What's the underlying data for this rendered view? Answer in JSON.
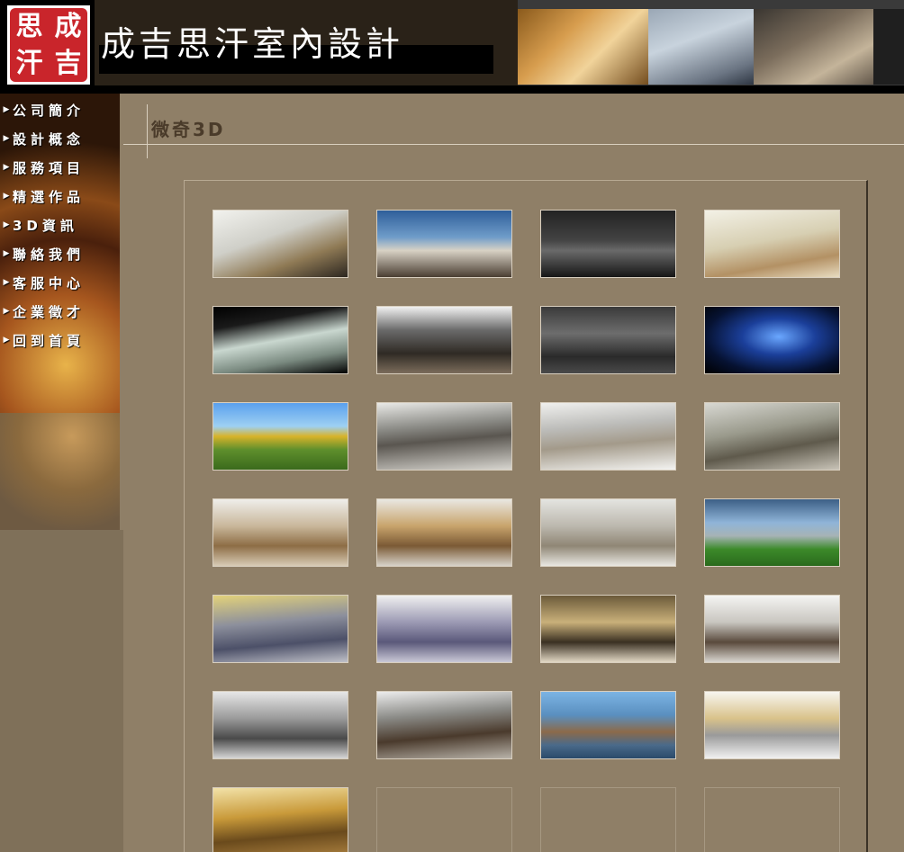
{
  "header": {
    "logo_chars": [
      "思",
      "成",
      "汗",
      "吉"
    ],
    "site_title": "成吉思汗室內設計"
  },
  "sidebar": {
    "items": [
      {
        "label": "公司簡介",
        "name": "company-intro"
      },
      {
        "label": "設計概念",
        "name": "design-concept"
      },
      {
        "label": "服務項目",
        "name": "services"
      },
      {
        "label": "精選作品",
        "name": "featured-works"
      },
      {
        "label": "3D資訊",
        "name": "3d-info"
      },
      {
        "label": "聯絡我們",
        "name": "contact-us"
      },
      {
        "label": "客服中心",
        "name": "customer-service"
      },
      {
        "label": "企業徵才",
        "name": "careers"
      },
      {
        "label": "回到首頁",
        "name": "home"
      }
    ]
  },
  "main": {
    "page_title": "微奇3D"
  },
  "gallery": {
    "thumbnails": [
      {
        "name": "white-ceiling-office-render",
        "bg": "linear-gradient(160deg,#f2f2ee 0%,#cfcfc8 40%,#8f7a55 70%,#2c2620 100%)"
      },
      {
        "name": "townhouse-exterior-render",
        "bg": "linear-gradient(180deg,#2f5f9a 0%,#6f9cc9 40%,#d8d2c5 60%,#4a3e32 100%)"
      },
      {
        "name": "dark-showroom-render",
        "bg": "linear-gradient(180deg,#222 0%,#444 45%,#6a6a6a 60%,#151515 100%)"
      },
      {
        "name": "living-dining-render",
        "bg": "linear-gradient(170deg,#f3f1e6 0%,#d7cfb2 45%,#b39164 75%,#e8dcc0 100%)"
      },
      {
        "name": "glass-building-render",
        "bg": "linear-gradient(170deg,#000 0%,#1a1a1a 25%,#c9d7cf 50%,#7a8a80 75%,#000 100%)"
      },
      {
        "name": "dark-dining-room-render",
        "bg": "linear-gradient(180deg,#f1f1f1 0%,#6a6a6a 35%,#2f2a24 70%,#7b6c5b 100%)"
      },
      {
        "name": "corridor-render",
        "bg": "linear-gradient(180deg,#3a3a3a 0%,#6d6d6d 40%,#2a2a2a 75%,#4a4a4a 100%)"
      },
      {
        "name": "exhibition-booth-render",
        "bg": "radial-gradient(ellipse at 55% 45%,#6aa7ff 0%,#1b3f9a 35%,#061232 70%,#000 100%)"
      },
      {
        "name": "cafe-terrace-render",
        "bg": "linear-gradient(180deg,#5aa0ee 0%,#9ed0f2 35%,#d8b32a 50%,#5f8f2c 70%,#3a6a1c 100%)"
      },
      {
        "name": "living-room-white-sofa-render",
        "bg": "linear-gradient(175deg,#e9e9e6 0%,#8b8b86 35%,#5a5650 55%,#d8d6d0 100%)"
      },
      {
        "name": "living-room-window-render",
        "bg": "linear-gradient(175deg,#f0f0ee 0%,#bcbcb9 35%,#a39a8a 60%,#f4f4f2 100%)"
      },
      {
        "name": "dining-balcony-render",
        "bg": "linear-gradient(170deg,#d8d8d2 0%,#9a9a8c 40%,#5f5a4c 65%,#c9c4b8 100%)"
      },
      {
        "name": "tv-wall-render",
        "bg": "linear-gradient(180deg,#efeeea 0%,#c9b79b 40%,#8d6d45 70%,#d8cbb5 100%)"
      },
      {
        "name": "living-wood-panel-render",
        "bg": "linear-gradient(180deg,#e9e7e2 0%,#c8a46c 40%,#7b5a35 70%,#d7d2c9 100%)"
      },
      {
        "name": "kitchen-dining-render",
        "bg": "linear-gradient(180deg,#e4e4e0 0%,#bcb8ae 40%,#8f8675 70%,#e9e7e1 100%)"
      },
      {
        "name": "villa-pool-render",
        "bg": "linear-gradient(180deg,#3c5f86 0%,#8fb4d8 35%,#a6b3b5 55%,#3c8a2a 75%,#2a6a1c 100%)"
      },
      {
        "name": "blue-kitchen-render",
        "bg": "linear-gradient(175deg,#e3d27a 0%,#8c8f9c 40%,#4c5068 70%,#bfc0c8 100%)"
      },
      {
        "name": "purple-kitchen-render",
        "bg": "linear-gradient(180deg,#f0f0f0 0%,#9c9ab4 40%,#5a587a 70%,#c9c8d6 100%)"
      },
      {
        "name": "bathroom-render",
        "bg": "linear-gradient(180deg,#6b5a3a 0%,#c9b07a 40%,#3a3022 70%,#e2d8c4 100%)"
      },
      {
        "name": "dining-pendant-render",
        "bg": "linear-gradient(180deg,#f4f4f2 0%,#c9c6c0 40%,#5a4a3c 70%,#d9d6d0 100%)"
      },
      {
        "name": "living-gray-render",
        "bg": "linear-gradient(180deg,#e6e6e6 0%,#9a9a9a 40%,#4a4a4a 70%,#d6d6d6 100%)"
      },
      {
        "name": "study-shelf-render",
        "bg": "linear-gradient(175deg,#ececec 0%,#8a8a86 35%,#4a3a2c 65%,#b8b2a8 100%)"
      },
      {
        "name": "twin-towers-render",
        "bg": "linear-gradient(180deg,#7cb4e4 0%,#5a8fbf 35%,#8c6a4a 60%,#4a6a8a 80%,#2a4a6a 100%)"
      },
      {
        "name": "bright-living-render",
        "bg": "linear-gradient(180deg,#f7f5ef 0%,#d9c28a 40%,#9a9a9a 65%,#f1f1f1 100%)"
      },
      {
        "name": "staircase-render",
        "bg": "linear-gradient(175deg,#f2e2a8 0%,#c99a3a 40%,#6a4a1c 70%,#a67c3c 100%)"
      },
      {
        "name": "empty-slot",
        "bg": ""
      },
      {
        "name": "empty-slot",
        "bg": ""
      },
      {
        "name": "empty-slot",
        "bg": ""
      }
    ]
  }
}
